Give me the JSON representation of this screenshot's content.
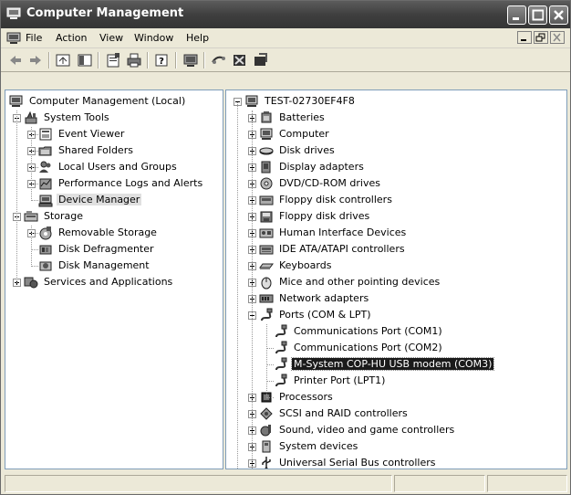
{
  "window": {
    "title": "Computer Management"
  },
  "menu": {
    "items": [
      {
        "label": "File"
      },
      {
        "label": "Action"
      },
      {
        "label": "View"
      },
      {
        "label": "Window"
      },
      {
        "label": "Help"
      }
    ]
  },
  "toolbar": {
    "icons": [
      "back-icon",
      "forward-icon",
      "up-icon",
      "show-hide-tree-icon",
      "properties-icon",
      "print-icon",
      "help-icon",
      "scan-hardware-icon",
      "update-driver-icon",
      "disable-icon",
      "uninstall-icon"
    ]
  },
  "left_tree": [
    {
      "label": "Computer Management (Local)",
      "icon": "computer-management-icon"
    },
    {
      "label": "System Tools",
      "icon": "system-tools-icon"
    },
    {
      "label": "Event Viewer",
      "icon": "event-viewer-icon"
    },
    {
      "label": "Shared Folders",
      "icon": "shared-folders-icon"
    },
    {
      "label": "Local Users and Groups",
      "icon": "users-groups-icon"
    },
    {
      "label": "Performance Logs and Alerts",
      "icon": "performance-logs-icon"
    },
    {
      "label": "Device Manager",
      "icon": "device-manager-icon",
      "selected": true
    },
    {
      "label": "Storage",
      "icon": "storage-icon"
    },
    {
      "label": "Removable Storage",
      "icon": "removable-storage-icon"
    },
    {
      "label": "Disk Defragmenter",
      "icon": "disk-defragmenter-icon"
    },
    {
      "label": "Disk Management",
      "icon": "disk-management-icon"
    },
    {
      "label": "Services and Applications",
      "icon": "services-icon"
    }
  ],
  "right_tree": [
    {
      "label": "TEST-02730EF4F8",
      "icon": "computer-icon"
    },
    {
      "label": "Batteries",
      "icon": "batteries-icon"
    },
    {
      "label": "Computer",
      "icon": "computer-icon"
    },
    {
      "label": "Disk drives",
      "icon": "disk-drive-icon"
    },
    {
      "label": "Display adapters",
      "icon": "display-adapter-icon"
    },
    {
      "label": "DVD/CD-ROM drives",
      "icon": "dvd-drive-icon"
    },
    {
      "label": "Floppy disk controllers",
      "icon": "floppy-controller-icon"
    },
    {
      "label": "Floppy disk drives",
      "icon": "floppy-drive-icon"
    },
    {
      "label": "Human Interface Devices",
      "icon": "hid-icon"
    },
    {
      "label": "IDE ATA/ATAPI controllers",
      "icon": "ide-controller-icon"
    },
    {
      "label": "Keyboards",
      "icon": "keyboard-icon"
    },
    {
      "label": "Mice and other pointing devices",
      "icon": "mouse-icon"
    },
    {
      "label": "Network adapters",
      "icon": "network-adapter-icon"
    },
    {
      "label": "Ports (COM & LPT)",
      "icon": "port-icon"
    },
    {
      "label": "Communications Port (COM1)",
      "icon": "port-icon"
    },
    {
      "label": "Communications Port (COM2)",
      "icon": "port-icon"
    },
    {
      "label": "M-System COP-HU USB modem (COM3)",
      "icon": "port-icon",
      "highlighted": true
    },
    {
      "label": "Printer Port (LPT1)",
      "icon": "port-icon"
    },
    {
      "label": "Processors",
      "icon": "processor-icon"
    },
    {
      "label": "SCSI and RAID controllers",
      "icon": "scsi-controller-icon"
    },
    {
      "label": "Sound, video and game controllers",
      "icon": "sound-icon"
    },
    {
      "label": "System devices",
      "icon": "system-devices-icon"
    },
    {
      "label": "Universal Serial Bus controllers",
      "icon": "usb-icon"
    }
  ]
}
